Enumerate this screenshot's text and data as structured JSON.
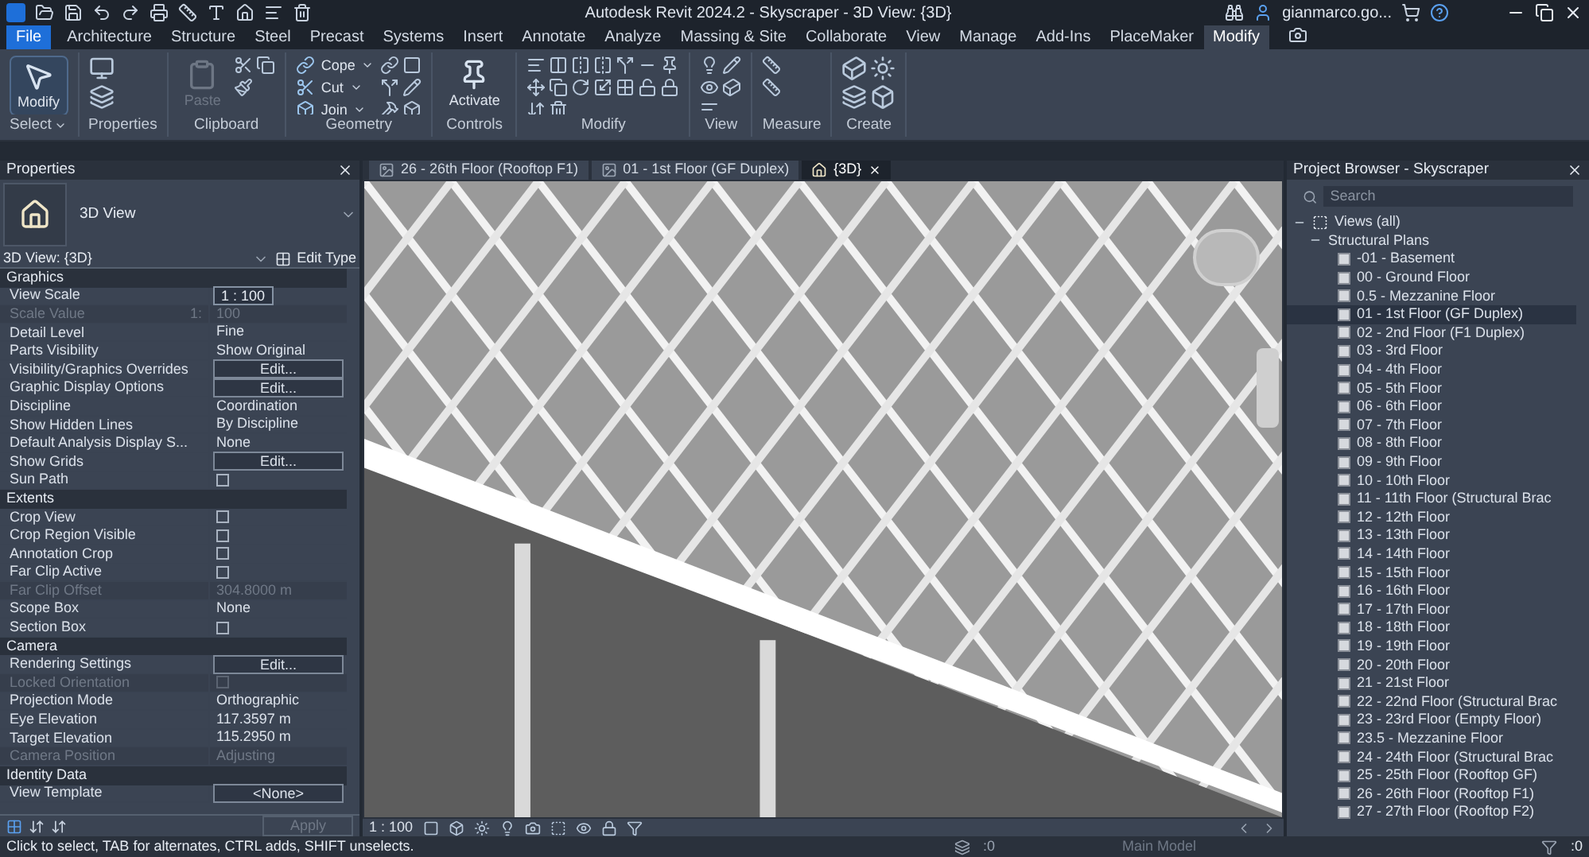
{
  "title_bar": {
    "title": "Autodesk Revit 2024.2 - Skyscraper - 3D View: {3D}",
    "user": "gianmarco.go..."
  },
  "ribbon_tabs": [
    {
      "label": "File",
      "selected": false,
      "kind": "file"
    },
    {
      "label": "Architecture",
      "selected": false,
      "kind": "tab"
    },
    {
      "label": "Structure",
      "selected": false,
      "kind": "tab"
    },
    {
      "label": "Steel",
      "selected": false,
      "kind": "tab"
    },
    {
      "label": "Precast",
      "selected": false,
      "kind": "tab"
    },
    {
      "label": "Systems",
      "selected": false,
      "kind": "tab"
    },
    {
      "label": "Insert",
      "selected": false,
      "kind": "tab"
    },
    {
      "label": "Annotate",
      "selected": false,
      "kind": "tab"
    },
    {
      "label": "Analyze",
      "selected": false,
      "kind": "tab"
    },
    {
      "label": "Massing & Site",
      "selected": false,
      "kind": "tab"
    },
    {
      "label": "Collaborate",
      "selected": false,
      "kind": "tab"
    },
    {
      "label": "View",
      "selected": false,
      "kind": "tab"
    },
    {
      "label": "Manage",
      "selected": false,
      "kind": "tab"
    },
    {
      "label": "Add-Ins",
      "selected": false,
      "kind": "tab"
    },
    {
      "label": "PlaceMaker",
      "selected": false,
      "kind": "tab"
    },
    {
      "label": "Modify",
      "selected": true,
      "kind": "tab"
    }
  ],
  "ribbon_panels": [
    {
      "label": "Select",
      "tools": [
        {
          "label": "Modify",
          "disabled": false
        }
      ]
    },
    {
      "label": "Properties"
    },
    {
      "label": "Clipboard",
      "tools": [
        {
          "label": "Paste",
          "disabled": true
        }
      ]
    },
    {
      "label": "Geometry",
      "tools": [
        {
          "label": "Cope",
          "disabled": false
        },
        {
          "label": "Cut",
          "disabled": false
        },
        {
          "label": "Join",
          "disabled": false
        }
      ]
    },
    {
      "label": "Controls",
      "tools": [
        {
          "label": "Activate",
          "disabled": false
        }
      ]
    },
    {
      "label": "Modify"
    },
    {
      "label": "View"
    },
    {
      "label": "Measure"
    },
    {
      "label": "Create"
    }
  ],
  "properties": {
    "title": "Properties",
    "type_name": "3D View",
    "view_selector": "3D View: {3D}",
    "edit_type": "Edit Type",
    "apply": "Apply",
    "groups": [
      {
        "name": "Graphics",
        "rows": [
          {
            "label": "View Scale",
            "kind": "field",
            "value": "1 : 100",
            "disabled": false
          },
          {
            "label": "Scale Value",
            "suffix": "1:",
            "kind": "text",
            "value": "100",
            "disabled": true
          },
          {
            "label": "Detail Level",
            "kind": "text",
            "value": "Fine",
            "disabled": false
          },
          {
            "label": "Parts Visibility",
            "kind": "text",
            "value": "Show Original",
            "disabled": false
          },
          {
            "label": "Visibility/Graphics Overrides",
            "kind": "button",
            "value": "Edit...",
            "disabled": false
          },
          {
            "label": "Graphic Display Options",
            "kind": "button",
            "value": "Edit...",
            "disabled": false
          },
          {
            "label": "Discipline",
            "kind": "text",
            "value": "Coordination",
            "disabled": false
          },
          {
            "label": "Show Hidden Lines",
            "kind": "text",
            "value": "By Discipline",
            "disabled": false
          },
          {
            "label": "Default Analysis Display S...",
            "kind": "text",
            "value": "None",
            "disabled": false
          },
          {
            "label": "Show Grids",
            "kind": "button",
            "value": "Edit...",
            "disabled": false
          },
          {
            "label": "Sun Path",
            "kind": "checkbox",
            "checked": false,
            "disabled": false
          }
        ]
      },
      {
        "name": "Extents",
        "rows": [
          {
            "label": "Crop View",
            "kind": "checkbox",
            "checked": false,
            "disabled": false
          },
          {
            "label": "Crop Region Visible",
            "kind": "checkbox",
            "checked": false,
            "disabled": false
          },
          {
            "label": "Annotation Crop",
            "kind": "checkbox",
            "checked": false,
            "disabled": false
          },
          {
            "label": "Far Clip Active",
            "kind": "checkbox",
            "checked": false,
            "disabled": false
          },
          {
            "label": "Far Clip Offset",
            "kind": "text",
            "value": "304.8000 m",
            "disabled": true
          },
          {
            "label": "Scope Box",
            "kind": "text",
            "value": "None",
            "disabled": false
          },
          {
            "label": "Section Box",
            "kind": "checkbox",
            "checked": false,
            "disabled": false
          }
        ]
      },
      {
        "name": "Camera",
        "rows": [
          {
            "label": "Rendering Settings",
            "kind": "button",
            "value": "Edit...",
            "disabled": false
          },
          {
            "label": "Locked Orientation",
            "kind": "checkbox",
            "checked": false,
            "disabled": true
          },
          {
            "label": "Projection Mode",
            "kind": "text",
            "value": "Orthographic",
            "disabled": false
          },
          {
            "label": "Eye Elevation",
            "kind": "text",
            "value": "117.3597 m",
            "disabled": false
          },
          {
            "label": "Target Elevation",
            "kind": "text",
            "value": "115.2950 m",
            "disabled": false
          },
          {
            "label": "Camera Position",
            "kind": "text",
            "value": "Adjusting",
            "disabled": true
          }
        ]
      },
      {
        "name": "Identity Data",
        "rows": [
          {
            "label": "View Template",
            "kind": "button",
            "value": "<None>",
            "disabled": false
          }
        ]
      }
    ]
  },
  "view_tabs": [
    {
      "label": "26 - 26th Floor (Rooftop F1)",
      "selected": false,
      "kind": "plan"
    },
    {
      "label": "01 - 1st Floor (GF Duplex)",
      "selected": false,
      "kind": "plan"
    },
    {
      "label": "{3D}",
      "selected": true,
      "kind": "model"
    }
  ],
  "view_bar": {
    "scale": "1 : 100"
  },
  "project_browser": {
    "title": "Project Browser - Skyscraper",
    "search": {
      "placeholder": "Search"
    },
    "tree": [
      {
        "label": "Views (all)",
        "expanded": true,
        "children": [
          {
            "label": "Structural Plans",
            "expanded": true,
            "children": [
              {
                "label": "-01 - Basement",
                "selected": false
              },
              {
                "label": "00 - Ground Floor",
                "selected": false
              },
              {
                "label": "0.5 - Mezzanine Floor",
                "selected": false
              },
              {
                "label": "01 - 1st Floor (GF Duplex)",
                "selected": true
              },
              {
                "label": "02 - 2nd Floor (F1 Duplex)",
                "selected": false
              },
              {
                "label": "03 - 3rd Floor",
                "selected": false
              },
              {
                "label": "04 - 4th Floor",
                "selected": false
              },
              {
                "label": "05 - 5th Floor",
                "selected": false
              },
              {
                "label": "06 - 6th Floor",
                "selected": false
              },
              {
                "label": "07 - 7th Floor",
                "selected": false
              },
              {
                "label": "08 - 8th Floor",
                "selected": false
              },
              {
                "label": "09 - 9th Floor",
                "selected": false
              },
              {
                "label": "10 - 10th Floor",
                "selected": false
              },
              {
                "label": "11 - 11th Floor (Structural Brac",
                "selected": false
              },
              {
                "label": "12 - 12th Floor",
                "selected": false
              },
              {
                "label": "13 - 13th Floor",
                "selected": false
              },
              {
                "label": "14 - 14th Floor",
                "selected": false
              },
              {
                "label": "15 - 15th Floor",
                "selected": false
              },
              {
                "label": "16 - 16th Floor",
                "selected": false
              },
              {
                "label": "17 - 17th Floor",
                "selected": false
              },
              {
                "label": "18 - 18th Floor",
                "selected": false
              },
              {
                "label": "19 - 19th Floor",
                "selected": false
              },
              {
                "label": "20 - 20th Floor",
                "selected": false
              },
              {
                "label": "21 - 21st Floor",
                "selected": false
              },
              {
                "label": "22 - 22nd Floor (Structural Brac",
                "selected": false
              },
              {
                "label": "23 - 23rd Floor (Empty Floor)",
                "selected": false
              },
              {
                "label": "23.5 - Mezzanine Floor",
                "selected": false
              },
              {
                "label": "24 - 24th Floor (Structural Brac",
                "selected": false
              },
              {
                "label": "25 - 25th Floor (Rooftop GF)",
                "selected": false
              },
              {
                "label": "26 - 26th Floor (Rooftop F1)",
                "selected": false
              },
              {
                "label": "27 - 27th Floor (Rooftop F2)",
                "selected": false
              }
            ]
          }
        ]
      }
    ]
  },
  "status_bar": {
    "message": "Click to select, TAB for alternates, CTRL adds, SHIFT unselects.",
    "worksets_count": ":0",
    "model": "Main Model",
    "filter_count": ":0"
  }
}
